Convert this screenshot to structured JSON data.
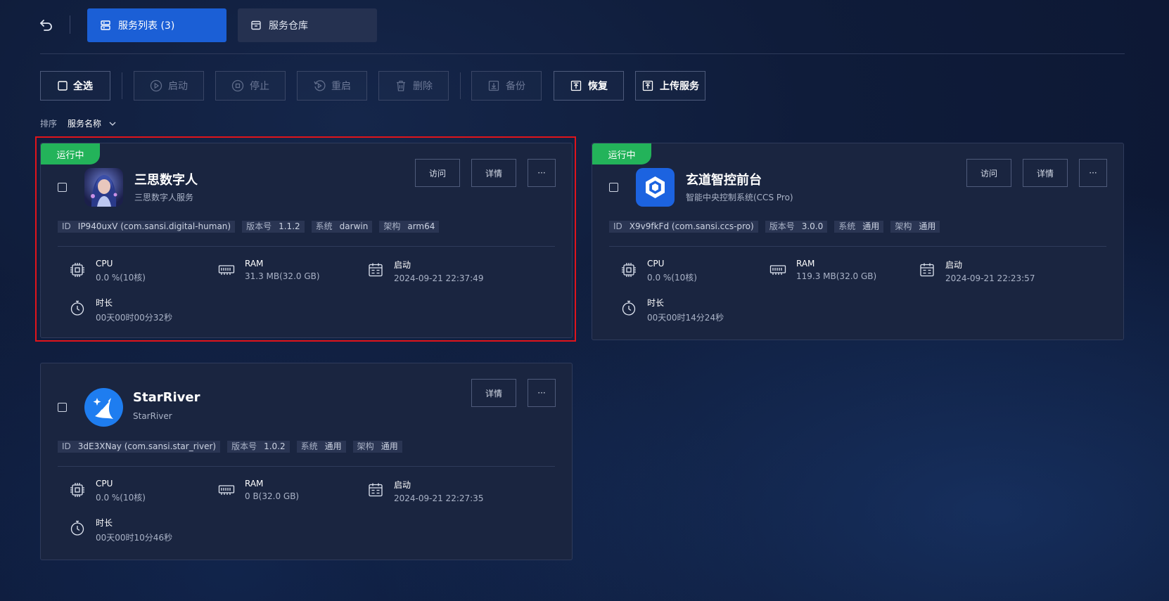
{
  "header": {
    "tabs": [
      {
        "label": "服务列表 (3)",
        "active": true
      },
      {
        "label": "服务仓库",
        "active": false
      }
    ]
  },
  "toolbar": {
    "select_all": "全选",
    "start": "启动",
    "stop": "停止",
    "restart": "重启",
    "delete": "删除",
    "backup": "备份",
    "restore": "恢复",
    "upload": "上传服务"
  },
  "sort": {
    "label": "排序",
    "value": "服务名称"
  },
  "colors": {
    "running": "#23b35a",
    "accent": "#1b5fd6",
    "selection_box": "#e0141b"
  },
  "services": [
    {
      "status": "运行中",
      "name": "三思数字人",
      "desc": "三思数字人服务",
      "icon": "digital-human-avatar",
      "buttons": {
        "visit": "访问",
        "detail": "详情",
        "more": "···"
      },
      "id_key": "ID",
      "id": "IP940uxV (com.sansi.digital-human)",
      "version_key": "版本号",
      "version": "1.1.2",
      "system_key": "系统",
      "system": "darwin",
      "arch_key": "架构",
      "arch": "arm64",
      "cpu_label": "CPU",
      "cpu": "0.0 %(10核)",
      "ram_label": "RAM",
      "ram": "31.3 MB(32.0 GB)",
      "start_label": "启动",
      "start": "2024-09-21 22:37:49",
      "duration_label": "时长",
      "duration": "00天00时00分32秒"
    },
    {
      "status": "运行中",
      "name": "玄道智控前台",
      "desc": "智能中央控制系统(CCS Pro)",
      "icon": "hexagon-logo",
      "buttons": {
        "visit": "访问",
        "detail": "详情",
        "more": "···"
      },
      "id_key": "ID",
      "id": "X9v9fkFd (com.sansi.ccs-pro)",
      "version_key": "版本号",
      "version": "3.0.0",
      "system_key": "系统",
      "system": "通用",
      "arch_key": "架构",
      "arch": "通用",
      "cpu_label": "CPU",
      "cpu": "0.0 %(10核)",
      "ram_label": "RAM",
      "ram": "119.3 MB(32.0 GB)",
      "start_label": "启动",
      "start": "2024-09-21 22:23:57",
      "duration_label": "时长",
      "duration": "00天00时14分24秒"
    },
    {
      "status": "",
      "name": "StarRiver",
      "desc": "StarRiver",
      "icon": "starriver-logo",
      "buttons": {
        "detail": "详情",
        "more": "···"
      },
      "id_key": "ID",
      "id": "3dE3XNay (com.sansi.star_river)",
      "version_key": "版本号",
      "version": "1.0.2",
      "system_key": "系统",
      "system": "通用",
      "arch_key": "架构",
      "arch": "通用",
      "cpu_label": "CPU",
      "cpu": "0.0 %(10核)",
      "ram_label": "RAM",
      "ram": "0 B(32.0 GB)",
      "start_label": "启动",
      "start": "2024-09-21 22:27:35",
      "duration_label": "时长",
      "duration": "00天00时10分46秒"
    }
  ]
}
